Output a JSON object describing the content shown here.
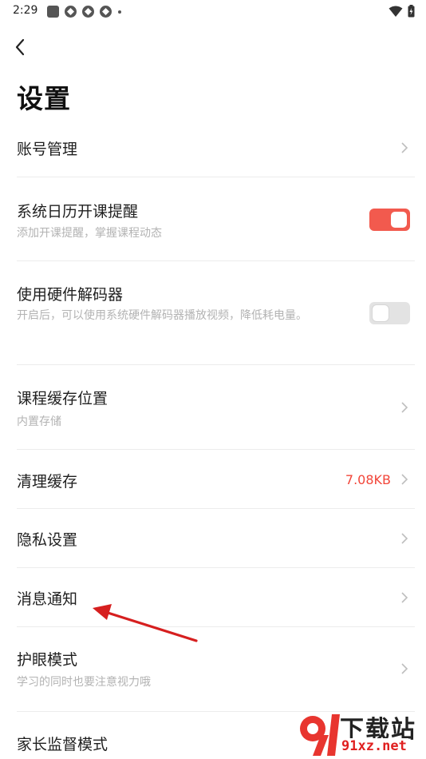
{
  "status_bar": {
    "time": "2:29"
  },
  "header": {
    "title": "设置"
  },
  "settings": {
    "account": {
      "title": "账号管理"
    },
    "calendar": {
      "title": "系统日历开课提醒",
      "subtitle": "添加开课提醒，掌握课程动态",
      "enabled": true
    },
    "decoder": {
      "title": "使用硬件解码器",
      "subtitle": "开启后，可以使用系统硬件解码器播放视频，降低耗电量。",
      "enabled": false
    },
    "cache_location": {
      "title": "课程缓存位置",
      "subtitle": "内置存储"
    },
    "clear_cache": {
      "title": "清理缓存",
      "value": "7.08KB"
    },
    "privacy": {
      "title": "隐私设置"
    },
    "notifications": {
      "title": "消息通知"
    },
    "eye_care": {
      "title": "护眼模式",
      "subtitle": "学习的同时也要注意视力哦"
    },
    "parental": {
      "title": "家长监督模式"
    }
  },
  "watermark": {
    "text": "下载站",
    "url": "91xz.net"
  },
  "colors": {
    "accent": "#f25a4e",
    "value_text": "#f2463a",
    "annotation_arrow": "#d61f1f"
  }
}
